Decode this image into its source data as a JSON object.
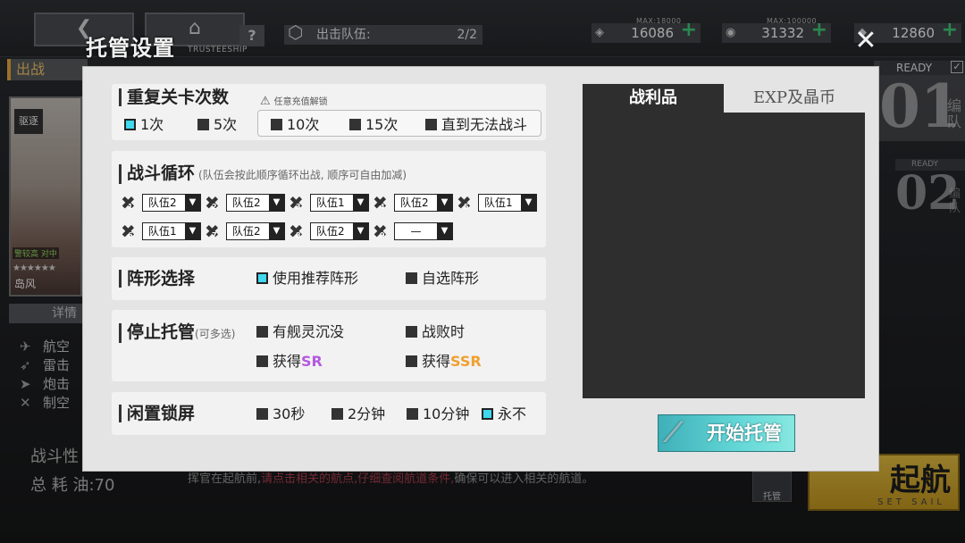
{
  "background": {
    "nav": {
      "back_icon": "back-arrow-icon",
      "home_icon": "home-icon"
    },
    "help_label": "?",
    "fleet_count": {
      "label": "出击队伍:",
      "value": "2/2"
    },
    "resources": [
      {
        "name": "oil",
        "max_label": "MAX:18000",
        "value": "16086",
        "plus": "+"
      },
      {
        "name": "gold",
        "max_label": "MAX:100000",
        "value": "31332",
        "plus": "+"
      },
      {
        "name": "gems",
        "max_label": "",
        "value": "12860",
        "plus": "+"
      }
    ],
    "sortie_label": "出战",
    "ship": {
      "type": "驱逐",
      "tag": "警较高  对中",
      "stars": "★★★★★★",
      "name": "岛风"
    },
    "detail_button": "详情",
    "side_stats": [
      {
        "label": "航空"
      },
      {
        "label": "雷击"
      },
      {
        "label": "炮击"
      },
      {
        "label": "制空"
      }
    ],
    "bottom_stats": {
      "line1": "战斗性",
      "line2": "总 耗 油:70"
    },
    "ready1": {
      "label": "READY",
      "number": "01",
      "side": "编队"
    },
    "ready2": {
      "label": "READY",
      "number": "02",
      "side": "编队"
    },
    "sail_button": {
      "title": "起航",
      "subtitle": "SET SAIL"
    },
    "trusteeship_small_button": "托管",
    "bottom_message": {
      "part1": "挥官在起航前,",
      "highlight": "请点击相关的航点,",
      "part2": "仔细查阅航道条件,",
      "part3": "确保可以进入相关的航道。"
    }
  },
  "modal": {
    "title": "托管设置",
    "subtitle": "TRUSTEESHIP",
    "close_icon": "close-x-icon",
    "repeat": {
      "title": "重复关卡次数",
      "warning": "任意充值解锁",
      "options": [
        {
          "label": "1次",
          "checked": true
        },
        {
          "label": "5次",
          "checked": false
        },
        {
          "label": "10次",
          "checked": false
        },
        {
          "label": "15次",
          "checked": false
        },
        {
          "label": "直到无法战斗",
          "checked": false
        }
      ]
    },
    "cycle": {
      "title": "战斗循环",
      "desc": "(队伍会按此顺序循环出战, 顺序可自由加减)",
      "slots": [
        {
          "index": "1",
          "value": "队伍2"
        },
        {
          "index": "2",
          "value": "队伍2"
        },
        {
          "index": "3",
          "value": "队伍1"
        },
        {
          "index": "4",
          "value": "队伍2"
        },
        {
          "index": "5",
          "value": "队伍1"
        },
        {
          "index": "6",
          "value": "队伍1"
        },
        {
          "index": "7",
          "value": "队伍2"
        },
        {
          "index": "8",
          "value": "队伍2"
        },
        {
          "index": "9",
          "value": "—"
        }
      ]
    },
    "formation": {
      "title": "阵形选择",
      "options": [
        {
          "label": "使用推荐阵形",
          "checked": true
        },
        {
          "label": "自选阵形",
          "checked": false
        }
      ]
    },
    "stop": {
      "title": "停止托管",
      "note": "(可多选)",
      "opt1": "有舰灵沉没",
      "opt2": "战败时",
      "opt3_prefix": "获得",
      "opt3_rarity": "SR",
      "opt4_prefix": "获得",
      "opt4_rarity": "SSR"
    },
    "idle": {
      "title": "闲置锁屏",
      "options": [
        {
          "label": "30秒",
          "checked": false
        },
        {
          "label": "2分钟",
          "checked": false
        },
        {
          "label": "10分钟",
          "checked": false
        },
        {
          "label": "永不",
          "checked": true
        }
      ]
    },
    "loot": {
      "tab_active": "战利品",
      "tab_inactive": "EXP及晶币"
    },
    "start_button": "开始托管"
  },
  "colors": {
    "checked": "#3fd8ee",
    "sr": "#b45ae0",
    "ssr": "#f0a030",
    "start_button": "#64d8d8"
  }
}
